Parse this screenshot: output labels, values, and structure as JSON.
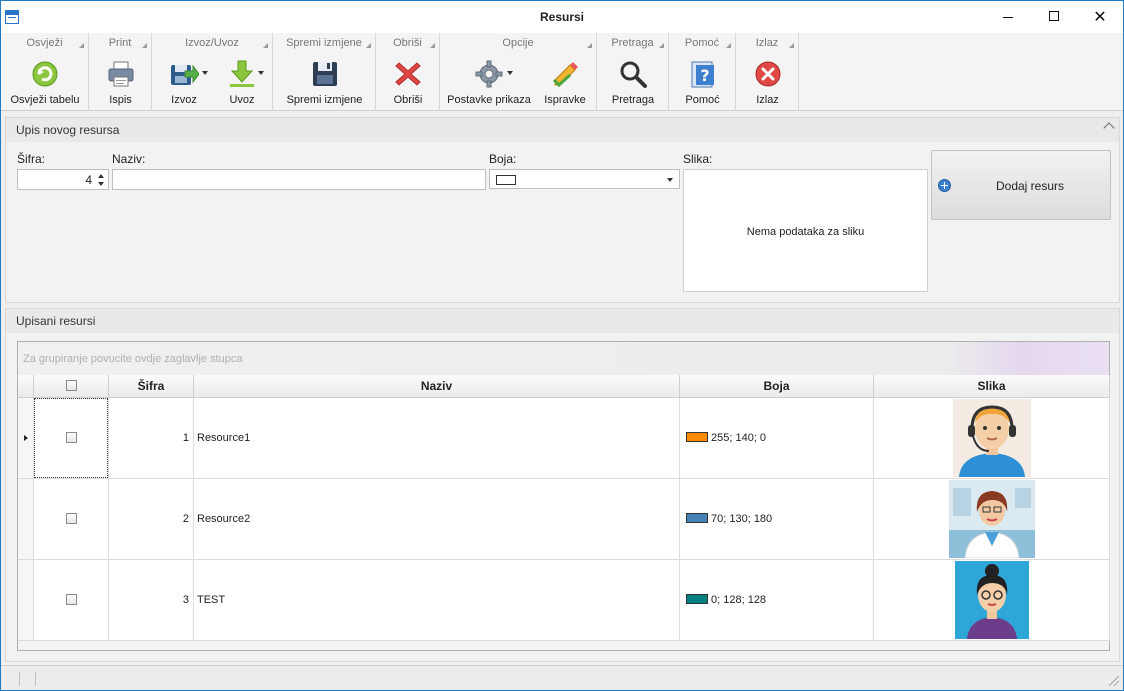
{
  "window": {
    "title": "Resursi"
  },
  "ribbon": {
    "groups": [
      {
        "title": "Osvježi",
        "buttons": [
          {
            "label": "Osvježi tabelu",
            "icon": "refresh-icon"
          }
        ]
      },
      {
        "title": "Print",
        "buttons": [
          {
            "label": "Ispis",
            "icon": "printer-icon"
          }
        ]
      },
      {
        "title": "Izvoz/Uvoz",
        "buttons": [
          {
            "label": "Izvoz",
            "icon": "export-icon"
          },
          {
            "label": "Uvoz",
            "icon": "import-icon"
          }
        ]
      },
      {
        "title": "Spremi izmjene",
        "buttons": [
          {
            "label": "Spremi izmjene",
            "icon": "save-icon"
          }
        ]
      },
      {
        "title": "Obriši",
        "buttons": [
          {
            "label": "Obriši",
            "icon": "delete-icon"
          }
        ]
      },
      {
        "title": "Opcije",
        "buttons": [
          {
            "label": "Postavke prikaza",
            "icon": "gear-icon"
          },
          {
            "label": "Ispravke",
            "icon": "pencil-check-icon"
          }
        ]
      },
      {
        "title": "Pretraga",
        "buttons": [
          {
            "label": "Pretraga",
            "icon": "search-icon"
          }
        ]
      },
      {
        "title": "Pomoć",
        "buttons": [
          {
            "label": "Pomoć",
            "icon": "help-icon"
          }
        ]
      },
      {
        "title": "Izlaz",
        "buttons": [
          {
            "label": "Izlaz",
            "icon": "exit-icon"
          }
        ]
      }
    ]
  },
  "form": {
    "title": "Upis novog resursa",
    "sifra_label": "Šifra:",
    "sifra_value": "4",
    "naziv_label": "Naziv:",
    "naziv_value": "",
    "boja_label": "Boja:",
    "slika_label": "Slika:",
    "slika_empty": "Nema podataka za sliku",
    "add_button": "Dodaj resurs",
    "colors": {
      "swatch": "#ffffff"
    }
  },
  "grid": {
    "title": "Upisani resursi",
    "group_hint": "Za grupiranje povucite ovdje zaglavlje stupca",
    "columns": [
      "Šifra",
      "Naziv",
      "Boja",
      "Slika"
    ],
    "rows": [
      {
        "sifra": "1",
        "naziv": "Resource1",
        "boja": "255; 140; 0",
        "color": "#ff8c00",
        "image": "avatar-support-agent"
      },
      {
        "sifra": "2",
        "naziv": "Resource2",
        "boja": "70; 130; 180",
        "color": "#4682b4",
        "image": "avatar-doctor"
      },
      {
        "sifra": "3",
        "naziv": "TEST",
        "boja": "0; 128; 128",
        "color": "#008080",
        "image": "avatar-woman-glasses"
      }
    ]
  }
}
